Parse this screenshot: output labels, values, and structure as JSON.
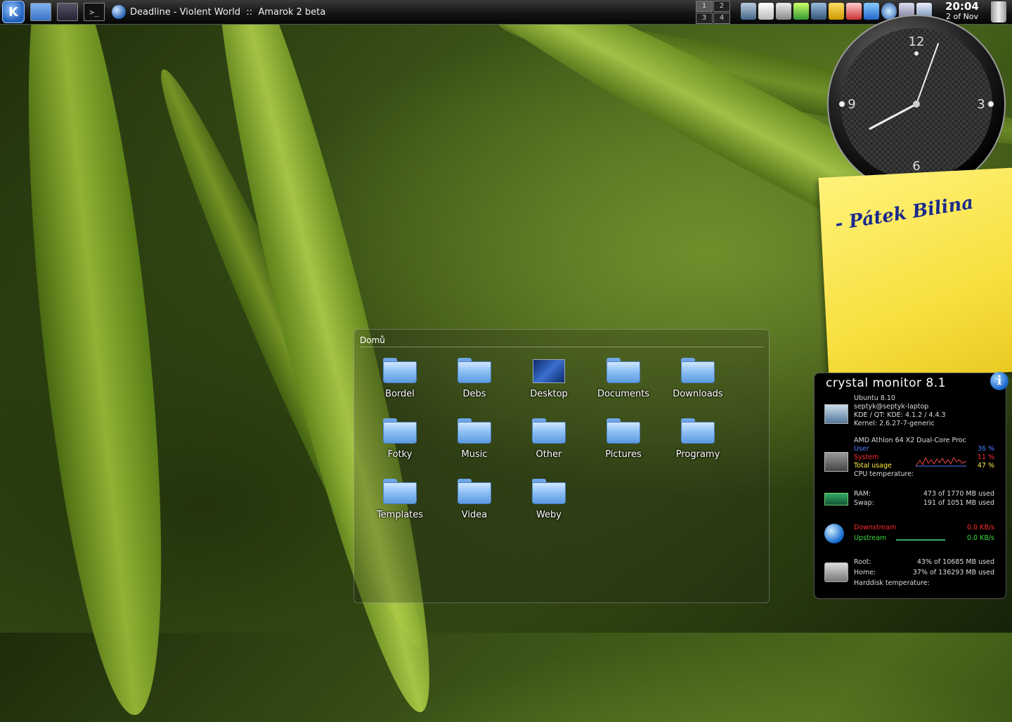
{
  "panel": {
    "kmenu_label": "K",
    "terminal_glyph": ">_",
    "task_title": "Deadline - Violent World  ::  Amarok 2 beta",
    "pager": [
      "1",
      "2",
      "3",
      "4"
    ],
    "clock_time": "20:04",
    "clock_date": "2 of Nov"
  },
  "analog_clock": {
    "numerals": [
      "12",
      "3",
      "6",
      "9"
    ],
    "time": "20:04"
  },
  "sticky_note": {
    "text": "- Pátek Bilina"
  },
  "folder_view": {
    "title": "Domů",
    "items": [
      {
        "label": "Bordel",
        "icon": "folder-icon"
      },
      {
        "label": "Debs",
        "icon": "folder-icon"
      },
      {
        "label": "Desktop",
        "icon": "desktop-folder-icon"
      },
      {
        "label": "Documents",
        "icon": "folder-icon"
      },
      {
        "label": "Downloads",
        "icon": "folder-icon"
      },
      {
        "label": "Fotky",
        "icon": "folder-icon"
      },
      {
        "label": "Music",
        "icon": "folder-icon"
      },
      {
        "label": "Other",
        "icon": "folder-icon"
      },
      {
        "label": "Pictures",
        "icon": "folder-icon"
      },
      {
        "label": "Programy",
        "icon": "folder-icon"
      },
      {
        "label": "Templates",
        "icon": "folder-icon"
      },
      {
        "label": "Videa",
        "icon": "folder-icon"
      },
      {
        "label": "Weby",
        "icon": "folder-icon"
      }
    ]
  },
  "crystal_monitor": {
    "title": "crystal monitor 8.1",
    "info_glyph": "i",
    "system": {
      "os": "Ubuntu 8.10",
      "host": "septyk@septyk-laptop",
      "kde": "KDE / QT: KDE: 4.1.2 / 4.4.3",
      "kernel": "Kernel: 2.6.27-7-generic"
    },
    "cpu": {
      "model": "AMD Athlon 64 X2 Dual-Core Proc",
      "user_label": "User",
      "user_value": "36 %",
      "system_label": "System",
      "system_value": "11 %",
      "total_label": "Total usage",
      "total_value": "47 %",
      "temp_label": "CPU temperature:"
    },
    "memory": {
      "ram_label": "RAM:",
      "ram_value": "473 of 1770 MB used",
      "swap_label": "Swap:",
      "swap_value": "191 of 1051 MB used"
    },
    "network": {
      "down_label": "Downstream",
      "down_value": "0.0 KB/s",
      "up_label": "Upstream",
      "up_value": "0.0 KB/s"
    },
    "disk": {
      "root_label": "Root:",
      "root_value": "43% of 10685 MB used",
      "home_label": "Home:",
      "home_value": "37% of 136293 MB used",
      "temp_label": "Harddisk temperature:"
    }
  }
}
